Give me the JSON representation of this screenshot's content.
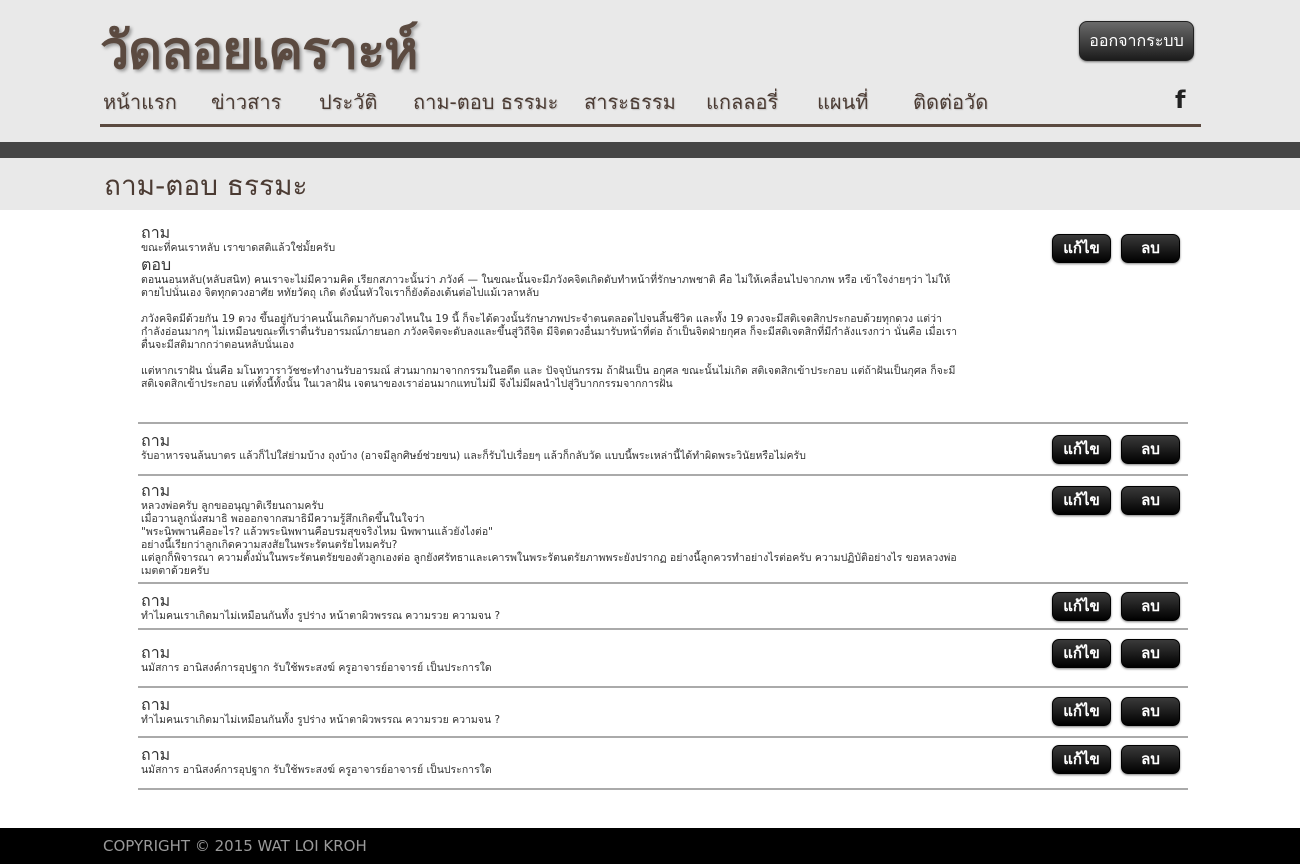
{
  "header": {
    "logo": "วัดลอยเคราะห์",
    "logout_label": "ออกจากระบบ",
    "nav": [
      "หน้าแรก",
      "ข่าวสาร",
      "ประวัติ",
      "ถาม-ตอบ ธรรมะ",
      "สาระธรรม",
      "แกลลอรี่",
      "แผนที่",
      "ติดต่อวัด"
    ],
    "social_icon": "f"
  },
  "page_title": "ถาม-ตอบ ธรรมะ",
  "labels": {
    "question": "ถาม",
    "answer": "ตอบ",
    "edit": "แก้ไข",
    "delete": "ลบ"
  },
  "qa": [
    {
      "question": "ขณะที่คนเราหลับ เราขาดสติแล้วใช่มั้ยครับ",
      "answer": [
        "ตอนนอนหลับ(หลับสนิท) คนเราจะไม่มีความคิด เรียกสภาวะนั้นว่า ภวังค์ — ในขณะนั้นจะมีภวังคจิตเกิดดับทำหน้าที่รักษาภพชาติ คือ ไม่ให้เคลื่อนไปจากภพ หรือ เข้าใจง่ายๆว่า ไม่ให้ตายไปนั่นเอง จิตทุกดวงอาศัย หทัยวัตถุ เกิด ดังนั้นหัวใจเราก็ยังต้องเต้นต่อไปแม้เวลาหลับ",
        "ภวังคจิตมีด้วยกัน 19 ดวง ขึ้นอยู่กับว่าคนนั้นเกิดมากับดวงไหนใน 19 นี้ ก็จะได้ดวงนั้นรักษาภพประจำตนตลอดไปจนสิ้นชีวิต และทั้ง 19 ดวงจะมีสติเจตสิกประกอบด้วยทุกดวง แต่ว่ากำลังอ่อนมากๆ ไม่เหมือนขณะที่เราตื่นรับอารมณ์ภายนอก ภวังคจิตจะดับลงและขึ้นสู่วิถีจิต มีจิตดวงอื่นมารับหน้าที่ต่อ ถ้าเป็นจิตฝ่ายกุศล ก็จะมีสติเจตสิกที่มีกำลังแรงกว่า นั่นคือ เมื่อเราตื่นจะมีสติมากกว่าตอนหลับนั่นเอง",
        "แต่หากเราฝัน นั่นคือ มโนทวาราวัชชะทำงานรับอารมณ์ ส่วนมากมาจากกรรมในอดีต และ ปัจจุบันกรรม ถ้าฝันเป็น อกุศล ขณะนั้นไม่เกิด สติเจตสิกเข้าประกอบ แต่ถ้าฝันเป็นกุศล ก็จะมีสติเจตสิกเข้าประกอบ แต่ทั้งนี้ทั้งนั้น ในเวลาฝัน เจตนาของเราอ่อนมากแทบไม่มี จึงไม่มีผลนำไปสู่วิบากกรรมจากการฝัน"
      ]
    },
    {
      "question": "รับอาหารจนล้นบาตร แล้วก็ไปใส่ย่ามบ้าง ถุงบ้าง (อาจมีลูกศิษย์ช่วยขน) และก็รับไปเรื่อยๆ แล้วก็กลับวัด แบบนี้พระเหล่านี้ได้ทำผิดพระวินัยหรือไม่ครับ",
      "answer": []
    },
    {
      "question": "หลวงพ่อครับ ลูกขออนุญาติเรียนถามครับ\nเมื่อวานลูกนั่งสมาธิ พอออกจากสมาธิมีความรู้สึกเกิดขึ้นในใจว่า\n\"พระนิพพานคืออะไร? แล้วพระนิพพานคือบรมสุขจริงไหม นิพพานแล้วยังไงต่อ\"\nอย่างนี้เรียกว่าลูกเกิดความสงสัยในพระรัตนตรัยไหมครับ?\nแต่ลูกก็พิจารณา ความตั้งมั่นในพระรัตนตรัยของตัวลูกเองต่อ ลูกยังศรัทธาและเคารพในพระรัตนตรัยภาพพระยังปรากฏ อย่างนี้ลูกควรทำอย่างไรต่อครับ ความปฏิบัติอย่างไร ขอหลวงพ่อเมตตาด้วยครับ",
      "answer": []
    },
    {
      "question": "ทำไมคนเราเกิดมาไม่เหมือนกันทั้ง รูปร่าง หน้าตาผิวพรรณ ความรวย ความจน ?",
      "answer": []
    },
    {
      "question": "นมัสการ อานิสงค์การอุปฐาก รับใช้พระสงฆ์ ครูอาจารย์อาจารย์ เป็นประการใด",
      "answer": []
    },
    {
      "question": "ทำไมคนเราเกิดมาไม่เหมือนกันทั้ง รูปร่าง หน้าตาผิวพรรณ ความรวย ความจน ?",
      "answer": []
    },
    {
      "question": "นมัสการ อานิสงค์การอุปฐาก รับใช้พระสงฆ์ ครูอาจารย์อาจารย์ เป็นประการใด",
      "answer": []
    }
  ],
  "footer": "COPYRIGHT © 2015 WAT LOI KROH"
}
